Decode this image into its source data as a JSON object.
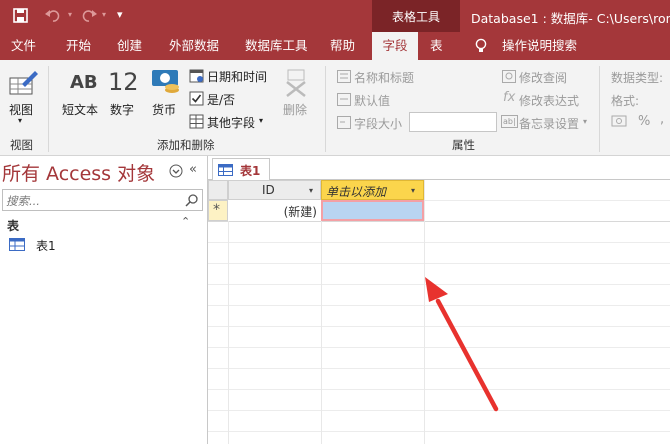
{
  "title_bar": {
    "context_group": "表格工具",
    "title": "Database1 : 数据库- C:\\Users\\rong"
  },
  "ribbon_tabs": [
    "文件",
    "开始",
    "创建",
    "外部数据",
    "数据库工具",
    "帮助",
    "字段",
    "表"
  ],
  "active_tab": "字段",
  "tell_me": "操作说明搜索",
  "groups": {
    "view": {
      "label": "视图",
      "button": "视图"
    },
    "add_delete": {
      "label": "添加和删除",
      "short_text": {
        "glyph": "AB",
        "label": "短文本"
      },
      "number": {
        "glyph": "12",
        "label": "数字"
      },
      "currency": "货币",
      "date_time": "日期和时间",
      "yes_no": "是/否",
      "more_fields": "其他字段",
      "delete": "删除"
    },
    "properties": {
      "label": "属性",
      "name_caption": "名称和标题",
      "default_value": "默认值",
      "field_size": "字段大小",
      "modify_lookups": "修改查阅",
      "modify_expression": "修改表达式",
      "memo_settings": "备忘录设置"
    },
    "formatting": {
      "data_type": "数据类型:",
      "format": "格式:",
      "percent": "%"
    }
  },
  "nav_pane": {
    "title": "所有 Access 对象",
    "search_placeholder": "搜索...",
    "section": "表",
    "items": [
      "表1"
    ]
  },
  "document": {
    "tab": "表1",
    "columns": [
      "ID",
      "单击以添加"
    ],
    "new_row": {
      "selector": "*",
      "id": "(新建)"
    }
  },
  "colors": {
    "accent": "#a4373a",
    "header_highlight": "#fbd54c",
    "arrow": "#e8322e"
  }
}
